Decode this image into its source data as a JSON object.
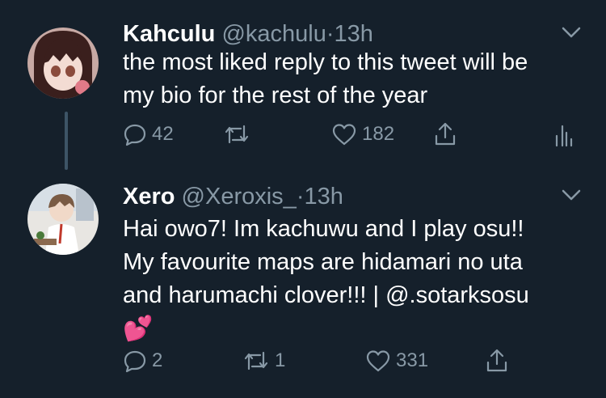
{
  "tweets": [
    {
      "name": "Kahculu",
      "handle": "@kachulu",
      "dot": "·",
      "time": "13h",
      "text_lines": [
        "the most liked reply to this tweet will be",
        "my bio for the rest of the year"
      ],
      "replies": "42",
      "retweets": "",
      "likes": "182"
    },
    {
      "name": "Xero",
      "handle": "@Xeroxis_",
      "dot": "·",
      "time": "13h",
      "text_lines": [
        "Hai owo7! Im kachuwu and I play osu!!",
        "My favourite maps are hidamari no uta",
        "and harumachi clover!!! | @.sotarksosu",
        "💕"
      ],
      "replies": "2",
      "retweets": "1",
      "likes": "331"
    }
  ],
  "colors": {
    "background": "#15202b",
    "muted": "#8899a6",
    "thread_line": "#3d5466"
  }
}
